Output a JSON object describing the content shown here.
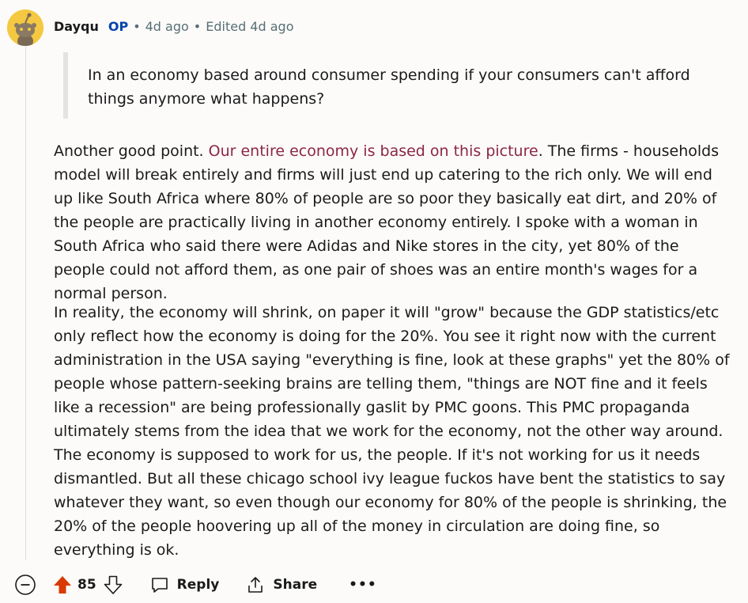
{
  "comment": {
    "author": "Dayqu",
    "op_badge": "OP",
    "separator": "•",
    "age": "4d ago",
    "edited": "Edited 4d ago",
    "quote": "In an economy based around consumer spending if your consumers can't afford things anymore what happens?",
    "para1_before": "Another good point. ",
    "para1_link": "Our entire economy is based on this picture",
    "para1_after": ". The firms - households model will break entirely and firms will just end up catering to the rich only. We will end up like South Africa where 80% of people are so poor they basically eat dirt, and 20% of the people are practically living in another economy entirely. I spoke with a woman in South Africa who said there were Adidas and Nike stores in the city, yet 80% of the people could not afford them, as one pair of shoes was an entire month's wages for a normal person.",
    "para2": "In reality, the economy will shrink, on paper it will \"grow\" because the GDP statistics/etc only reflect how the economy is doing for the 20%. You see it right now with the current administration in the USA saying \"everything is fine, look at these graphs\" yet the 80% of people whose pattern-seeking brains are telling them, \"things are NOT fine and it feels like a recession\" are being professionally gaslit by PMC goons. This PMC propaganda ultimately stems from the idea that we work for the economy, not the other way around. The economy is supposed to work for us, the people. If it's not working for us it needs dismantled. But all these chicago school ivy league fuckos have bent the statistics to say whatever they want, so even though our economy for 80% of the people is shrinking, the 20% of the people hoovering up all of the money in circulation are doing fine, so everything is ok."
  },
  "actions": {
    "votes": "85",
    "reply_label": "Reply",
    "share_label": "Share",
    "more_label": "•••"
  },
  "colors": {
    "upvote_active": "#d93a00",
    "op": "#0045ac",
    "link": "#8c2645",
    "meta": "#576f76"
  }
}
